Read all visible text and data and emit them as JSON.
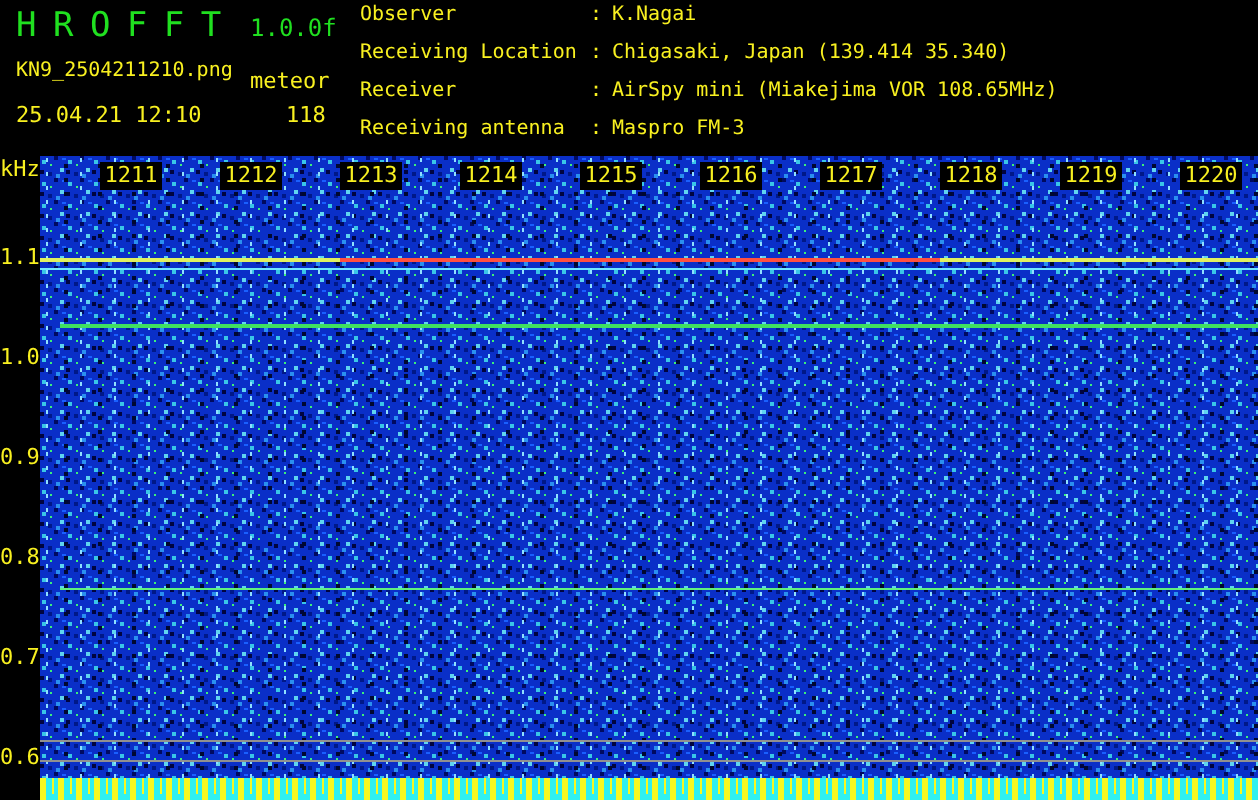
{
  "header": {
    "app_name": "H R O F F T",
    "version": "1.0.0f",
    "filename": "KN9_2504211210.png",
    "datetime": "25.04.21 12:10",
    "count_label": "meteor",
    "count": "118"
  },
  "info": [
    {
      "label": "Observer",
      "separator": ":",
      "value": "K.Nagai"
    },
    {
      "label": "Receiving Location",
      "separator": ":",
      "value": "Chigasaki, Japan (139.414 35.340)"
    },
    {
      "label": "Receiver",
      "separator": ":",
      "value": "AirSpy mini (Miakejima VOR 108.65MHz)"
    },
    {
      "label": "Receiving antenna",
      "separator": ":",
      "value": "Maspro FM-3"
    }
  ],
  "spectrogram": {
    "y_unit": "kHz",
    "y_labels": [
      "1.1",
      "1.0",
      "0.9",
      "0.8",
      "0.7",
      "0.6"
    ],
    "time_labels": [
      "1211",
      "1212",
      "1213",
      "1214",
      "1215",
      "1216",
      "1217",
      "1218",
      "1219",
      "1220"
    ]
  }
}
